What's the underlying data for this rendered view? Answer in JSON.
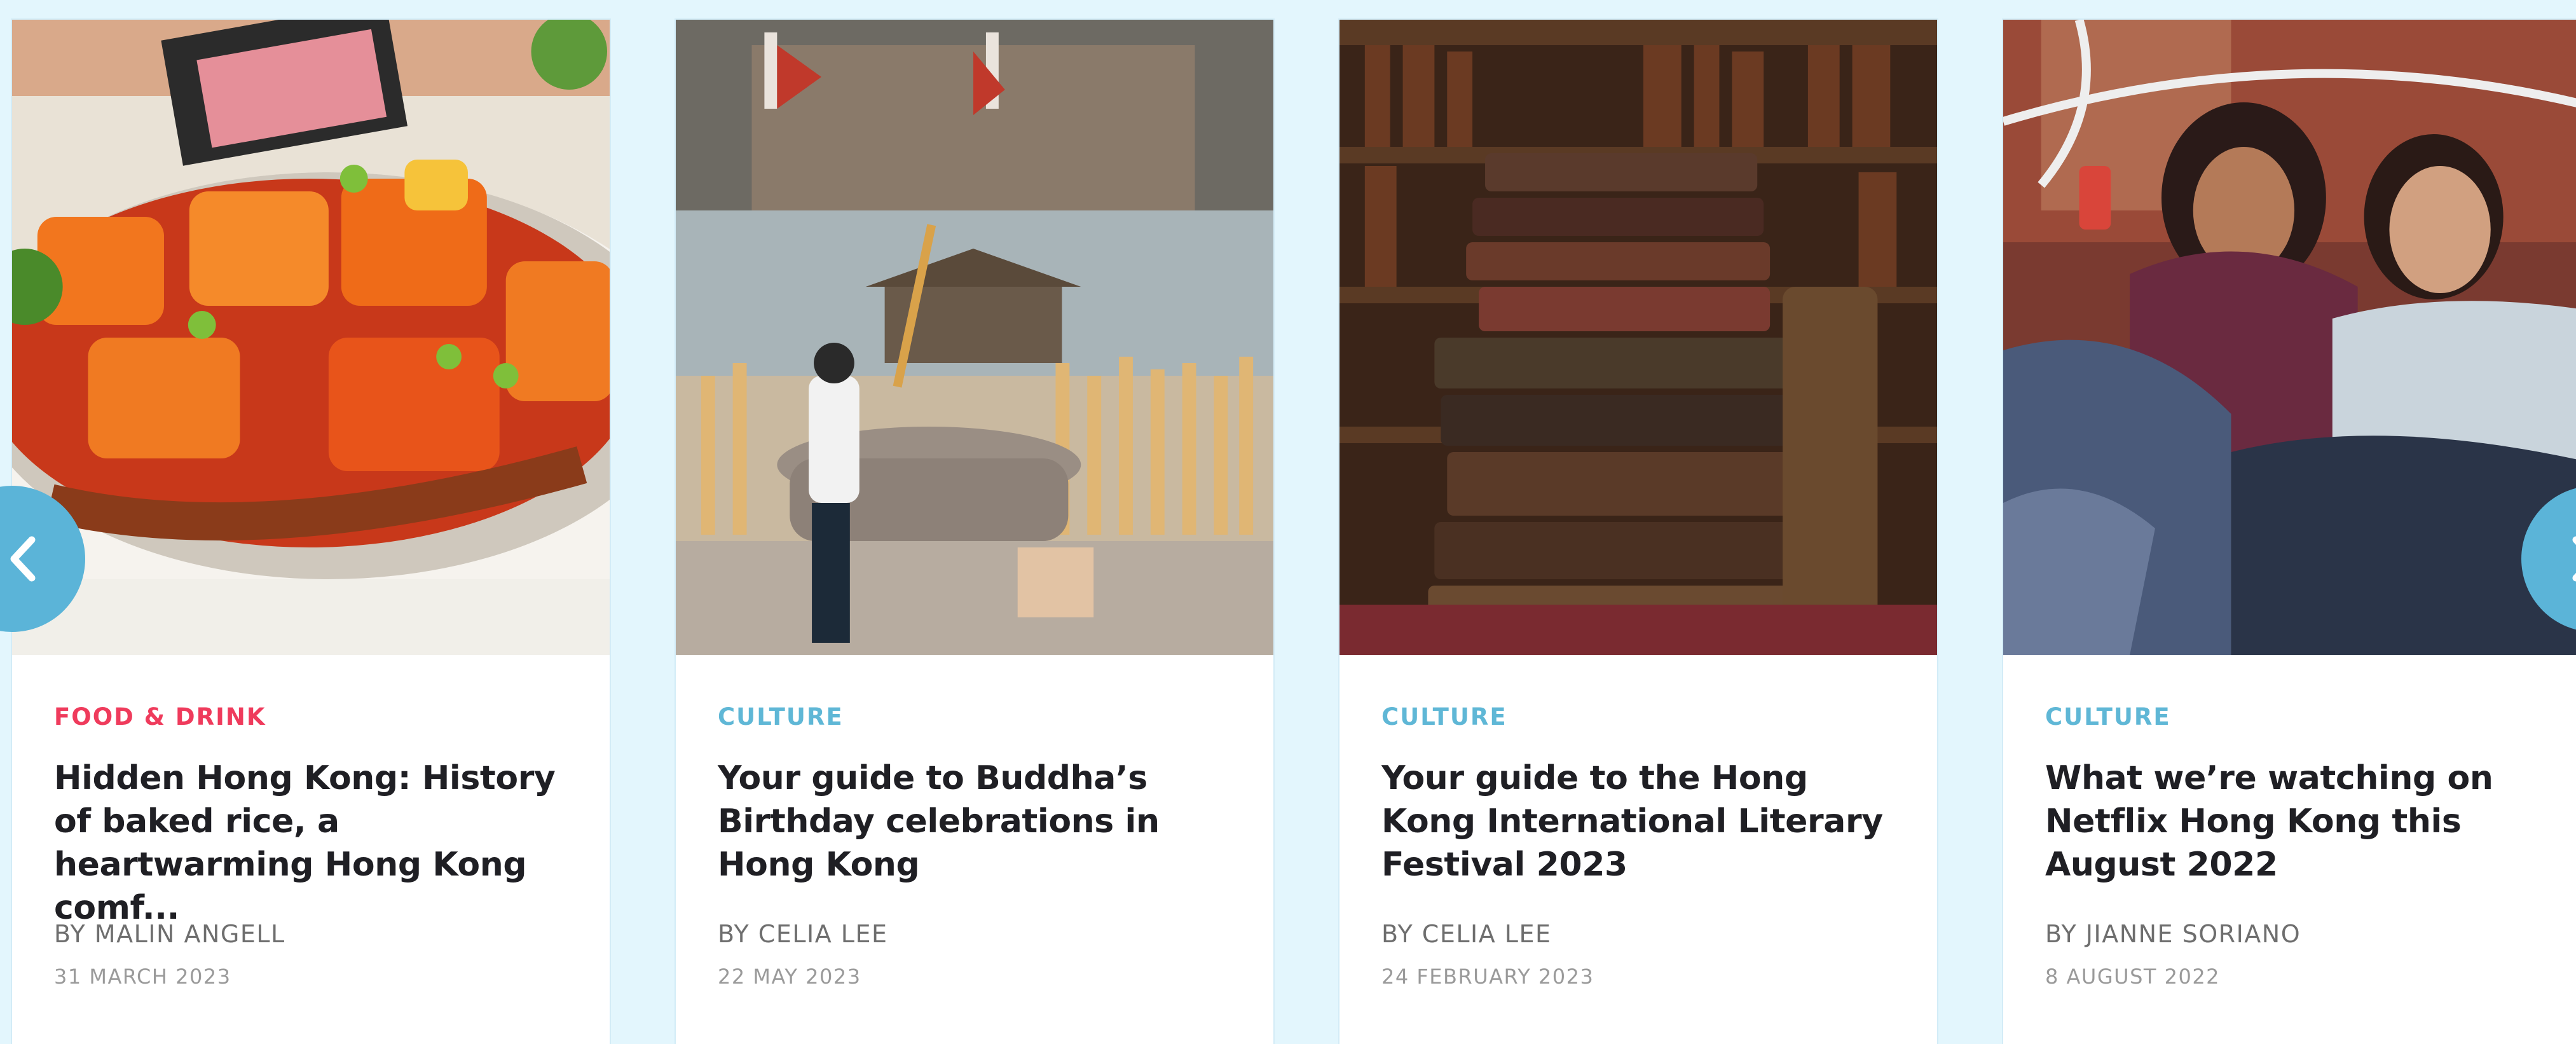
{
  "articles": [
    {
      "category": "FOOD & DRINK",
      "title": "Hidden Hong Kong: History of baked rice, a heartwarming Hong Kong comf...",
      "author": "BY MALIN ANGELL",
      "date": "31 MARCH 2023",
      "image": "baked-rice-photo"
    },
    {
      "category": "CULTURE",
      "title": "Your guide to Buddha’s Birthday celebrations in Hong Kong",
      "author": "BY CELIA LEE",
      "date": "22 MAY 2023",
      "image": "temple-incense-photo"
    },
    {
      "category": "CULTURE",
      "title": "Your guide to the Hong Kong International Literary Festival 2023",
      "author": "BY CELIA LEE",
      "date": "24 FEBRUARY 2023",
      "image": "stacked-books-photo"
    },
    {
      "category": "CULTURE",
      "title": "What we’re watching on Netflix Hong Kong this August 2022",
      "author": "BY JIANNE SORIANO",
      "date": "8 AUGUST 2022",
      "image": "netflix-couple-photo"
    }
  ],
  "colors": {
    "background": "#e3f6fd",
    "food_drink": "#ef3b5c",
    "culture": "#5fb7d6",
    "nav_button": "#5bb4d8"
  },
  "icons": {
    "prev": "chevron-left-icon",
    "next": "chevron-right-icon"
  }
}
